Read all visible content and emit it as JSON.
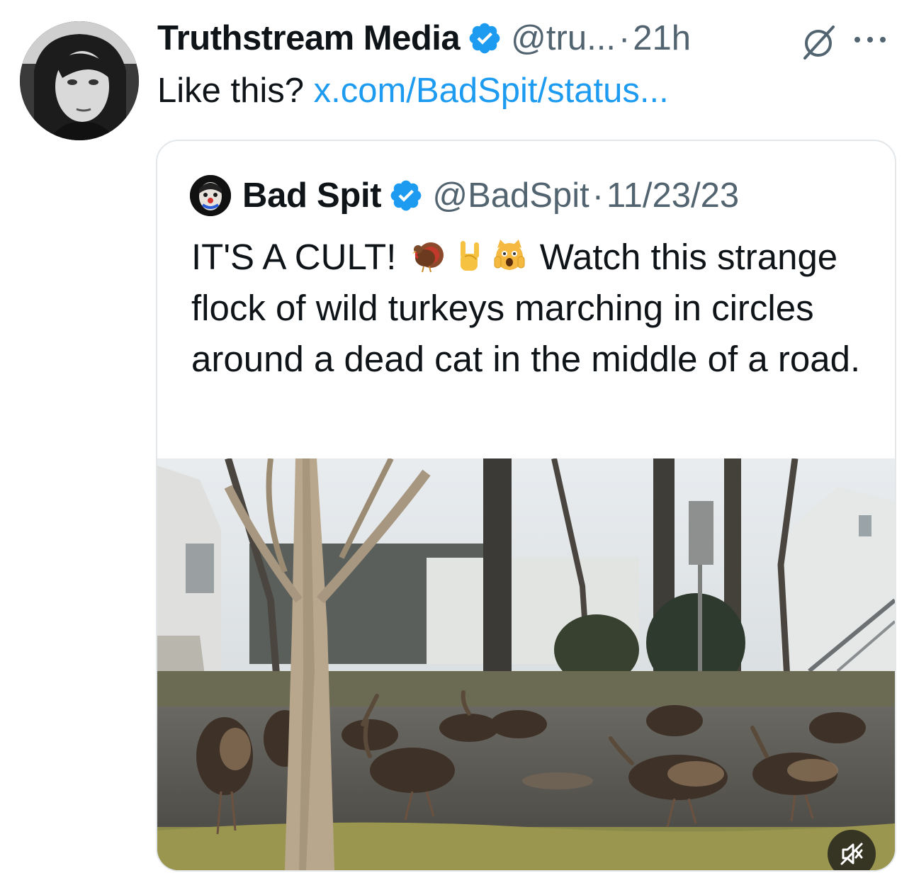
{
  "tweet": {
    "author": {
      "display_name": "Truthstream Media",
      "handle": "@tru...",
      "avatar_icon": "profile-photo"
    },
    "separator": "·",
    "time": "21h",
    "text": "Like this? ",
    "link": "x.com/BadSpit/status...",
    "icons": [
      "verified-badge-icon",
      "grok-icon",
      "more-icon"
    ]
  },
  "quoted_tweet": {
    "author": {
      "display_name": "Bad Spit",
      "handle": "@BadSpit",
      "avatar_icon": "profile-photo"
    },
    "separator": "·",
    "date": "11/23/23",
    "text_lead": "IT'S A CULT! ",
    "emojis": [
      "turkey",
      "sign-of-the-horns",
      "weary-cat"
    ],
    "text_rest": " Watch this strange flock of wild turkeys marching in circles around a dead cat in the middle of a road.",
    "media": {
      "type": "video",
      "muted": true,
      "icon": "mute-icon"
    }
  },
  "colors": {
    "text": "#0f1419",
    "secondary": "#536471",
    "link": "#1d9bf0",
    "verified": "#1d9bf0",
    "border": "#e3e7ea"
  }
}
